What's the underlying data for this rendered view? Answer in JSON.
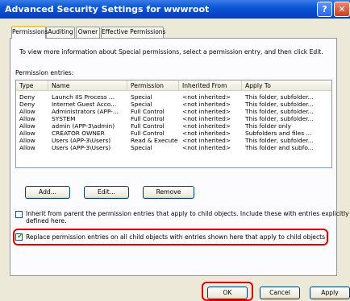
{
  "window": {
    "title": "Advanced Security Settings for wwwroot"
  },
  "titlebar": {
    "help_glyph": "?",
    "close_glyph": "✕"
  },
  "tabs": [
    "Permissions",
    "Auditing",
    "Owner",
    "Effective Permissions"
  ],
  "intro_text": "To view more information about Special permissions, select a permission entry, and then click Edit.",
  "entries_label": "Permission entries:",
  "columns": [
    "Type",
    "Name",
    "Permission",
    "Inherited From",
    "Apply To"
  ],
  "rows": [
    [
      "Deny",
      "Launch IIS Process ...",
      "Special",
      "<not inherited>",
      "This folder, subfolder..."
    ],
    [
      "Deny",
      "Internet Guest Acco...",
      "Special",
      "<not inherited>",
      "This folder, subfolder..."
    ],
    [
      "Allow",
      "Administrators (APP-...",
      "Full Control",
      "<not inherited>",
      "This folder, subfolder..."
    ],
    [
      "Allow",
      "SYSTEM",
      "Full Control",
      "<not inherited>",
      "This folder, subfolder..."
    ],
    [
      "Allow",
      "admin (APP-3\\admin)",
      "Full Control",
      "<not inherited>",
      "This folder only"
    ],
    [
      "Allow",
      "CREATOR OWNER",
      "Full Control",
      "<not inherited>",
      "Subfolders and files ..."
    ],
    [
      "Allow",
      "Users (APP-3\\Users)",
      "Read & Execute",
      "<not inherited>",
      "This folder, subfolder..."
    ],
    [
      "Allow",
      "Users (APP-3\\Users)",
      "Special",
      "<not inherited>",
      "This folder and subfo..."
    ]
  ],
  "buttons": {
    "add": "Add...",
    "edit": "Edit...",
    "remove": "Remove",
    "ok": "OK",
    "cancel": "Cancel",
    "apply": "Apply"
  },
  "inherit_checkbox": {
    "label_line1": "Inherit from parent the permission entries that apply to child objects. Include these with entries explicitly",
    "label_line2": "defined here.",
    "checked": false
  },
  "replace_checkbox": {
    "label": "Replace permission entries on all child objects with entries shown here that apply to child objects",
    "checked": true,
    "check_glyph": "✔"
  },
  "colors": {
    "highlight": "#e30000",
    "titlebar": "#0a56d6"
  }
}
